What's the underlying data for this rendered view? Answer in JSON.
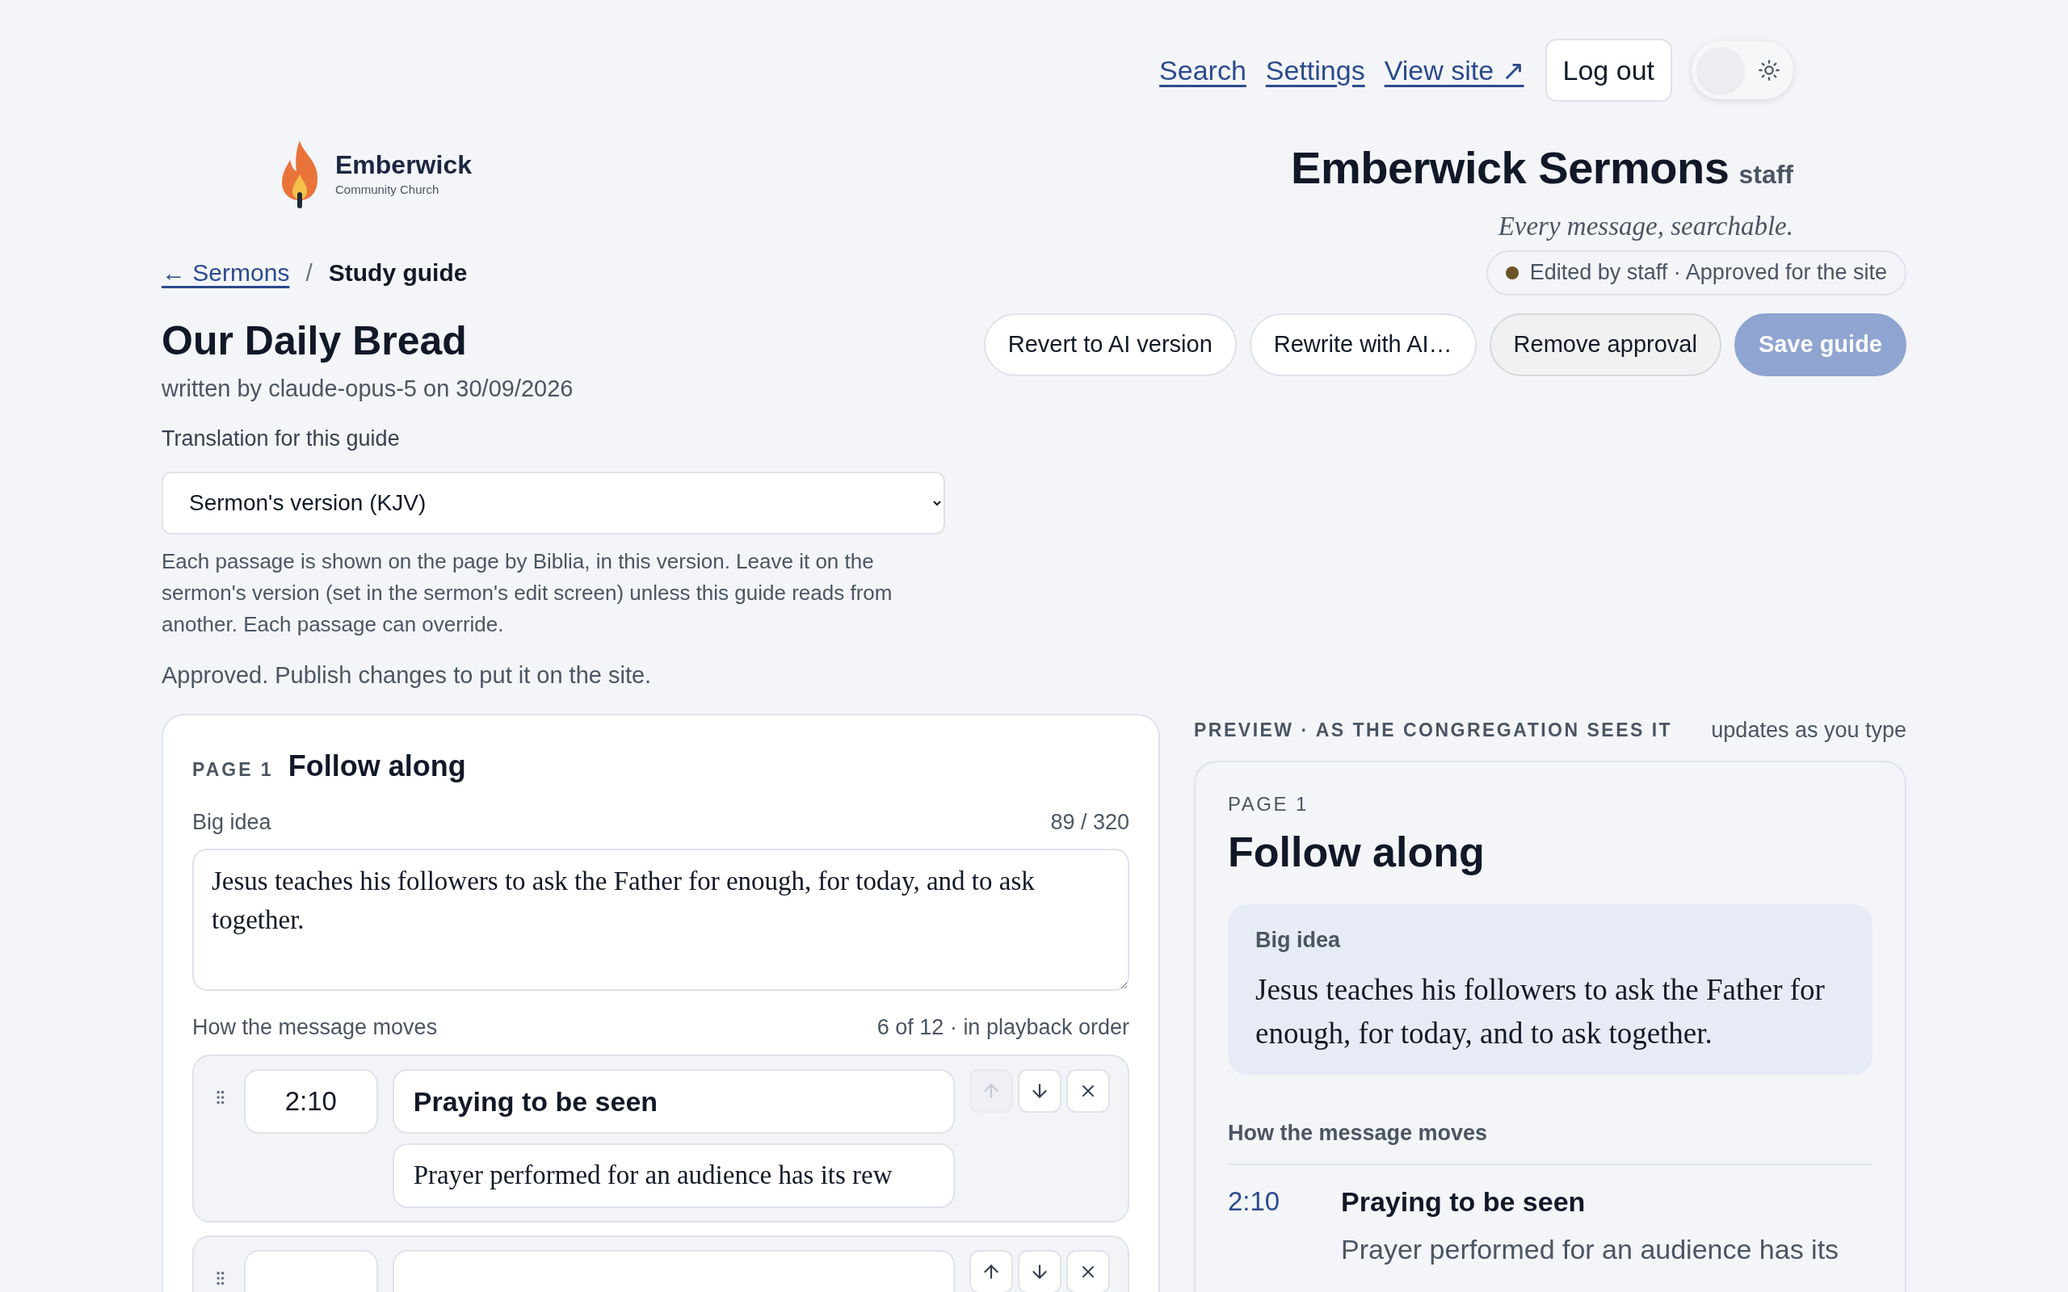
{
  "nav": {
    "links": [
      "Search",
      "Settings",
      "View site ↗"
    ],
    "logout": "Log out",
    "theme_toggle": {
      "on": false
    }
  },
  "brand": {
    "name": "Emberwick",
    "subtitle": "Community Church"
  },
  "site": {
    "title": "Emberwick Sermons",
    "badge": "staff",
    "tagline": "Every message, searchable."
  },
  "breadcrumb": {
    "link": "← Sermons",
    "separator": "/",
    "current": "Study guide"
  },
  "status": {
    "text": "Edited by staff · Approved for the site",
    "color": "#6b5424"
  },
  "guide": {
    "title": "Our Daily Bread",
    "byline": "written by claude-opus-5 on 30/09/2026",
    "buttons": [
      {
        "label": "Revert to AI version",
        "kind": "outline",
        "disabled": false
      },
      {
        "label": "Rewrite with AI…",
        "kind": "outline",
        "disabled": false
      },
      {
        "label": "Remove approval",
        "kind": "muted",
        "disabled": false
      },
      {
        "label": "Save guide",
        "kind": "primary",
        "disabled": true
      }
    ]
  },
  "translation": {
    "label": "Translation for this guide",
    "value": "Sermon's version (KJV)",
    "help": "Each passage is shown on the page by Biblia, in this version. Leave it on the sermon's version (set in the sermon's edit screen) unless this guide reads from another. Each passage can override.",
    "note": "Approved. Publish changes to put it on the site."
  },
  "editor": {
    "page_label": "PAGE 1",
    "title": "Follow along",
    "big_idea": {
      "label": "Big idea",
      "count": "89 / 320",
      "value": "Jesus teaches his followers to ask the Father for enough, for today, and to ask together."
    },
    "moves": {
      "label": "How the message moves",
      "count": "6 of 12 · in playback order",
      "items": [
        {
          "time": "2:10",
          "title": "Praying to be seen",
          "description": "Prayer performed for an audience has its rew",
          "up_disabled": true
        },
        {
          "up_disabled": false
        }
      ]
    }
  },
  "preview": {
    "label": "PREVIEW · AS THE CONGREGATION SEES IT",
    "note": "updates as you type",
    "page_label": "PAGE 1",
    "title": "Follow along",
    "big_idea": {
      "label": "Big idea",
      "text": "Jesus teaches his followers to ask the Father for enough, for today, and to ask together."
    },
    "moves_label": "How the message moves",
    "moves": [
      {
        "time": "2:10",
        "title": "Praying to be seen",
        "description": "Prayer performed for an audience has its"
      }
    ]
  }
}
